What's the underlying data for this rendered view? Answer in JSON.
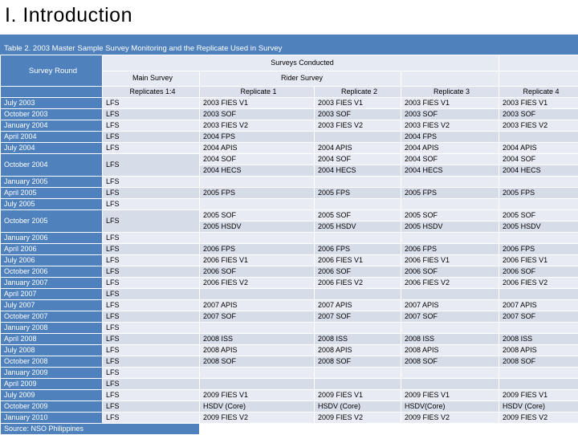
{
  "slide": {
    "title": "I.  Introduction"
  },
  "table": {
    "caption": "Table 2.  2003 Master Sample Survey Monitoring and the Replicate Used in Survey",
    "header": {
      "survey_round": "Survey Round",
      "surveys_conducted": "Surveys Conducted",
      "main_survey": "Main Survey",
      "rider_survey": "Rider Survey",
      "replicates_1_4": "Replicates 1:4",
      "replicate_1": "Replicate 1",
      "replicate_2": "Replicate 2",
      "replicate_3": "Replicate 3",
      "replicate_4": "Replicate 4",
      "spacer": ""
    },
    "rows": [
      {
        "round": "July 2003",
        "main": "LFS",
        "r1": "2003 FIES V1",
        "r2": "2003 FIES V1",
        "r3": "2003 FIES V1",
        "r4": "2003 FIES V1"
      },
      {
        "round": "October 2003",
        "main": "LFS",
        "r1": "2003 SOF",
        "r2": "2003 SOF",
        "r3": "2003 SOF",
        "r4": "2003 SOF"
      },
      {
        "round": "January 2004",
        "main": "LFS",
        "r1": "2003 FIES V2",
        "r2": "2003 FIES V2",
        "r3": "2003 FIES V2",
        "r4": "2003 FIES V2"
      },
      {
        "round": "April 2004",
        "main": "LFS",
        "r1": "2004 FPS",
        "r2": "",
        "r3": "2004 FPS",
        "r4": ""
      },
      {
        "round": "July 2004",
        "main": "LFS",
        "r1": "2004 APIS",
        "r2": "2004 APIS",
        "r3": "2004 APIS",
        "r4": "2004 APIS"
      },
      {
        "round": "October 2004",
        "main": "LFS",
        "tall": true,
        "sub": [
          {
            "r1": "2004 SOF",
            "r2": "2004 SOF",
            "r3": "2004 SOF",
            "r4": "2004 SOF"
          },
          {
            "r1": "2004 HECS",
            "r2": "2004 HECS",
            "r3": "2004 HECS",
            "r4": "2004 HECS"
          }
        ]
      },
      {
        "round": "January 2005",
        "main": "LFS",
        "r1": "",
        "r2": "",
        "r3": "",
        "r4": ""
      },
      {
        "round": "April 2005",
        "main": "LFS",
        "r1": "2005 FPS",
        "r2": "2005 FPS",
        "r3": "2005 FPS",
        "r4": "2005 FPS"
      },
      {
        "round": "July 2005",
        "main": "LFS",
        "r1": "",
        "r2": "",
        "r3": "",
        "r4": ""
      },
      {
        "round": "October 2005",
        "main": "LFS",
        "tall": true,
        "sub": [
          {
            "r1": "2005 SOF",
            "r2": "2005 SOF",
            "r3": "2005 SOF",
            "r4": "2005 SOF"
          },
          {
            "r1": "2005 HSDV",
            "r2": "2005 HSDV",
            "r3": "2005 HSDV",
            "r4": "2005 HSDV"
          }
        ]
      },
      {
        "round": "January 2006",
        "main": "LFS",
        "r1": "",
        "r2": "",
        "r3": "",
        "r4": ""
      },
      {
        "round": "April 2006",
        "main": "LFS",
        "r1": "2006 FPS",
        "r2": "2006 FPS",
        "r3": "2006 FPS",
        "r4": "2006 FPS"
      },
      {
        "round": "July 2006",
        "main": "LFS",
        "r1": "2006 FIES V1",
        "r2": "2006 FIES V1",
        "r3": "2006 FIES V1",
        "r4": "2006 FIES V1"
      },
      {
        "round": "October 2006",
        "main": "LFS",
        "r1": "2006 SOF",
        "r2": "2006 SOF",
        "r3": "2006 SOF",
        "r4": "2006 SOF"
      },
      {
        "round": "January 2007",
        "main": "LFS",
        "r1": "2006 FIES V2",
        "r2": "2006 FIES V2",
        "r3": "2006 FIES V2",
        "r4": "2006 FIES V2"
      },
      {
        "round": "April 2007",
        "main": "LFS",
        "r1": "",
        "r2": "",
        "r3": "",
        "r4": ""
      },
      {
        "round": "July 2007",
        "main": "LFS",
        "r1": "2007 APIS",
        "r2": "2007 APIS",
        "r3": "2007 APIS",
        "r4": "2007 APIS"
      },
      {
        "round": "October 2007",
        "main": "LFS",
        "r1": "2007 SOF",
        "r2": "2007 SOF",
        "r3": "2007 SOF",
        "r4": "2007 SOF"
      },
      {
        "round": "January 2008",
        "main": "LFS",
        "r1": "",
        "r2": "",
        "r3": "",
        "r4": ""
      },
      {
        "round": "April 2008",
        "main": "LFS",
        "r1": "2008 ISS",
        "r2": "2008 ISS",
        "r3": "2008 ISS",
        "r4": "2008 ISS"
      },
      {
        "round": "July 2008",
        "main": "LFS",
        "r1": "2008 APIS",
        "r2": "2008 APIS",
        "r3": "2008 APIS",
        "r4": "2008 APIS"
      },
      {
        "round": "October 2008",
        "main": "LFS",
        "r1": "2008 SOF",
        "r2": "2008 SOF",
        "r3": "2008 SOF",
        "r4": "2008 SOF"
      },
      {
        "round": "January 2009",
        "main": "LFS",
        "r1": "",
        "r2": "",
        "r3": "",
        "r4": ""
      },
      {
        "round": "April 2009",
        "main": "LFS",
        "r1": "",
        "r2": "",
        "r3": "",
        "r4": ""
      },
      {
        "round": "July 2009",
        "main": "LFS",
        "r1": "2009 FIES V1",
        "r2": "2009 FIES V1",
        "r3": "2009 FIES V1",
        "r4": "2009 FIES V1"
      },
      {
        "round": "October 2009",
        "main": "LFS",
        "r1": "HSDV (Core)",
        "r2": "HSDV (Core)",
        "r3": "HSDV(Core)",
        "r4": "HSDV (Core)"
      },
      {
        "round": "January 2010",
        "main": "LFS",
        "r1": "2009 FIES V2",
        "r2": "2009 FIES V2",
        "r3": "2009 FIES V2",
        "r4": "2009 FIES V2"
      }
    ],
    "source": "Source:  NSO Philippines"
  },
  "colors": {
    "accent_blue": "#4f81bd",
    "band_light": "#e8ebf3",
    "band_dark": "#d7dce9",
    "header_light": "#e6eaf2"
  }
}
